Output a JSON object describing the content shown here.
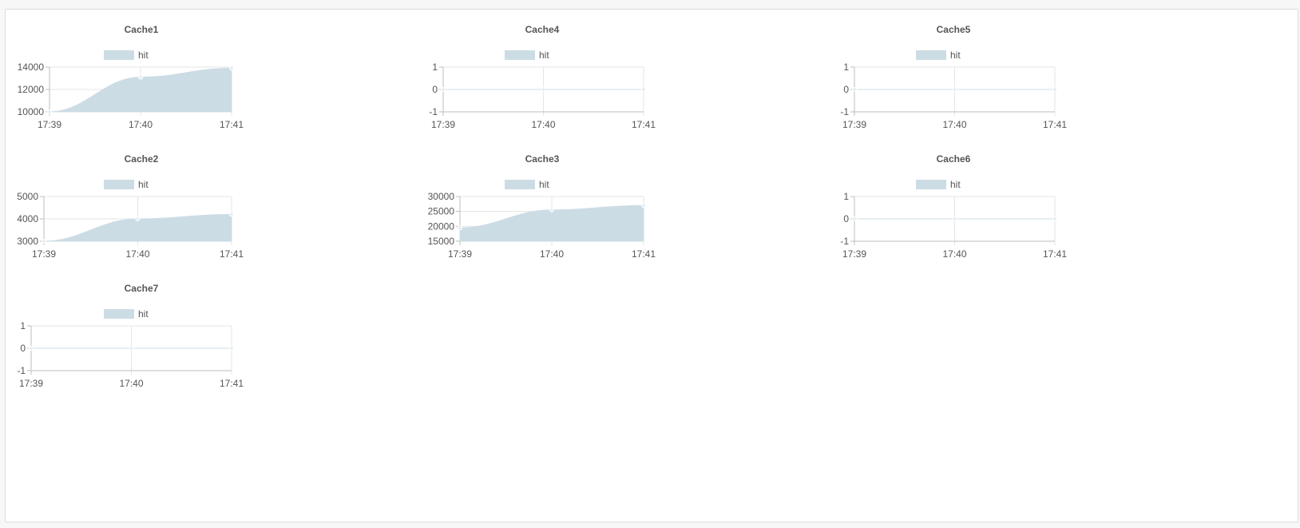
{
  "colors": {
    "fill": "#ccdce4",
    "legend_box": "#ccdce4",
    "point": "#e6eef2",
    "grid": "#e5e5e5",
    "axis": "#bdbdbd"
  },
  "chart_data": [
    {
      "id": "cache1",
      "type": "area",
      "title": "Cache1",
      "x": [
        "17:39",
        "17:40",
        "17:41"
      ],
      "series": [
        {
          "name": "hit",
          "values": [
            10000,
            13100,
            13900
          ]
        }
      ],
      "ylim": [
        10000,
        14000
      ],
      "yticks": [
        10000,
        12000,
        14000
      ],
      "legend": "top"
    },
    {
      "id": "cache4",
      "type": "area",
      "title": "Cache4",
      "x": [
        "17:39",
        "17:40",
        "17:41"
      ],
      "series": [
        {
          "name": "hit",
          "values": [
            0,
            0,
            0
          ]
        }
      ],
      "ylim": [
        -1,
        1
      ],
      "yticks": [
        -1,
        0,
        1
      ],
      "legend": "top"
    },
    {
      "id": "cache5",
      "type": "area",
      "title": "Cache5",
      "x": [
        "17:39",
        "17:40",
        "17:41"
      ],
      "series": [
        {
          "name": "hit",
          "values": [
            0,
            0,
            0
          ]
        }
      ],
      "ylim": [
        -1,
        1
      ],
      "yticks": [
        -1,
        0,
        1
      ],
      "legend": "top"
    },
    {
      "id": "cache2",
      "type": "area",
      "title": "Cache2",
      "x": [
        "17:39",
        "17:40",
        "17:41"
      ],
      "series": [
        {
          "name": "hit",
          "values": [
            3000,
            4000,
            4200
          ]
        }
      ],
      "ylim": [
        3000,
        5000
      ],
      "yticks": [
        3000,
        4000,
        5000
      ],
      "legend": "top"
    },
    {
      "id": "cache3",
      "type": "area",
      "title": "Cache3",
      "x": [
        "17:39",
        "17:40",
        "17:41"
      ],
      "series": [
        {
          "name": "hit",
          "values": [
            19500,
            25500,
            27000
          ]
        }
      ],
      "ylim": [
        15000,
        30000
      ],
      "yticks": [
        15000,
        20000,
        25000,
        30000
      ],
      "legend": "top"
    },
    {
      "id": "cache6",
      "type": "area",
      "title": "Cache6",
      "x": [
        "17:39",
        "17:40",
        "17:41"
      ],
      "series": [
        {
          "name": "hit",
          "values": [
            0,
            0,
            0
          ]
        }
      ],
      "ylim": [
        -1,
        1
      ],
      "yticks": [
        -1,
        0,
        1
      ],
      "legend": "top"
    },
    {
      "id": "cache7",
      "type": "area",
      "title": "Cache7",
      "x": [
        "17:39",
        "17:40",
        "17:41"
      ],
      "series": [
        {
          "name": "hit",
          "values": [
            0,
            0,
            0
          ]
        }
      ],
      "ylim": [
        -1,
        1
      ],
      "yticks": [
        -1,
        0,
        1
      ],
      "legend": "top"
    }
  ]
}
